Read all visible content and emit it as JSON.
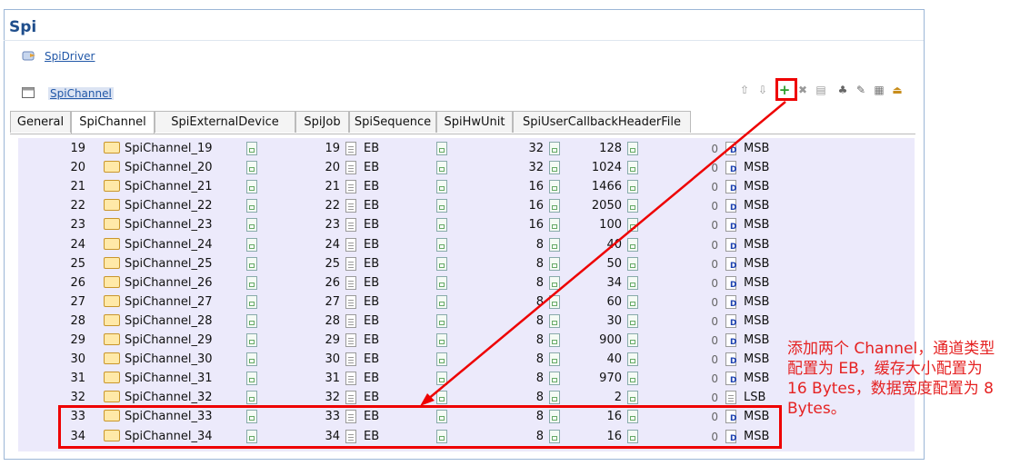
{
  "page_title": "Spi",
  "nav": {
    "driver_link": "SpiDriver",
    "channel_link": "SpiChannel"
  },
  "tabs": [
    "General",
    "SpiChannel",
    "SpiExternalDevice",
    "SpiJob",
    "SpiSequence",
    "SpiHwUnit",
    "SpiUserCallbackHeaderFile"
  ],
  "toolbar_icons": [
    "up-arrow-icon",
    "down-arrow-icon",
    "add-icon",
    "delete-icon",
    "copy-icon",
    "user-icon",
    "edit-icon",
    "table-icon",
    "import-icon"
  ],
  "rows": [
    {
      "idx": "19",
      "name": "SpiChannel_19",
      "id": "19",
      "type": "EB",
      "width": "32",
      "buf": "128",
      "def": "0",
      "order": "MSB"
    },
    {
      "idx": "20",
      "name": "SpiChannel_20",
      "id": "20",
      "type": "EB",
      "width": "32",
      "buf": "1024",
      "def": "0",
      "order": "MSB"
    },
    {
      "idx": "21",
      "name": "SpiChannel_21",
      "id": "21",
      "type": "EB",
      "width": "16",
      "buf": "1466",
      "def": "0",
      "order": "MSB"
    },
    {
      "idx": "22",
      "name": "SpiChannel_22",
      "id": "22",
      "type": "EB",
      "width": "16",
      "buf": "2050",
      "def": "0",
      "order": "MSB"
    },
    {
      "idx": "23",
      "name": "SpiChannel_23",
      "id": "23",
      "type": "EB",
      "width": "16",
      "buf": "100",
      "def": "0",
      "order": "MSB"
    },
    {
      "idx": "24",
      "name": "SpiChannel_24",
      "id": "24",
      "type": "EB",
      "width": "8",
      "buf": "40",
      "def": "0",
      "order": "MSB"
    },
    {
      "idx": "25",
      "name": "SpiChannel_25",
      "id": "25",
      "type": "EB",
      "width": "8",
      "buf": "50",
      "def": "0",
      "order": "MSB"
    },
    {
      "idx": "26",
      "name": "SpiChannel_26",
      "id": "26",
      "type": "EB",
      "width": "8",
      "buf": "34",
      "def": "0",
      "order": "MSB"
    },
    {
      "idx": "27",
      "name": "SpiChannel_27",
      "id": "27",
      "type": "EB",
      "width": "8",
      "buf": "60",
      "def": "0",
      "order": "MSB"
    },
    {
      "idx": "28",
      "name": "SpiChannel_28",
      "id": "28",
      "type": "EB",
      "width": "8",
      "buf": "30",
      "def": "0",
      "order": "MSB"
    },
    {
      "idx": "29",
      "name": "SpiChannel_29",
      "id": "29",
      "type": "EB",
      "width": "8",
      "buf": "900",
      "def": "0",
      "order": "MSB"
    },
    {
      "idx": "30",
      "name": "SpiChannel_30",
      "id": "30",
      "type": "EB",
      "width": "8",
      "buf": "40",
      "def": "0",
      "order": "MSB"
    },
    {
      "idx": "31",
      "name": "SpiChannel_31",
      "id": "31",
      "type": "EB",
      "width": "8",
      "buf": "970",
      "def": "0",
      "order": "MSB"
    },
    {
      "idx": "32",
      "name": "SpiChannel_32",
      "id": "32",
      "type": "EB",
      "width": "8",
      "buf": "2",
      "def": "0",
      "order": "LSB"
    },
    {
      "idx": "33",
      "name": "SpiChannel_33",
      "id": "33",
      "type": "EB",
      "width": "8",
      "buf": "16",
      "def": "0",
      "order": "MSB"
    },
    {
      "idx": "34",
      "name": "SpiChannel_34",
      "id": "34",
      "type": "EB",
      "width": "8",
      "buf": "16",
      "def": "0",
      "order": "MSB"
    }
  ],
  "annotation": "添加两个 Channel，通道类型配置为 EB，缓存大小配置为 16 Bytes，数据宽度配置为 8 Bytes。",
  "colors": {
    "annotation": "#e52222",
    "grid_bg": "#eceafb",
    "link": "#2258a8",
    "title": "#1f4e8c"
  }
}
